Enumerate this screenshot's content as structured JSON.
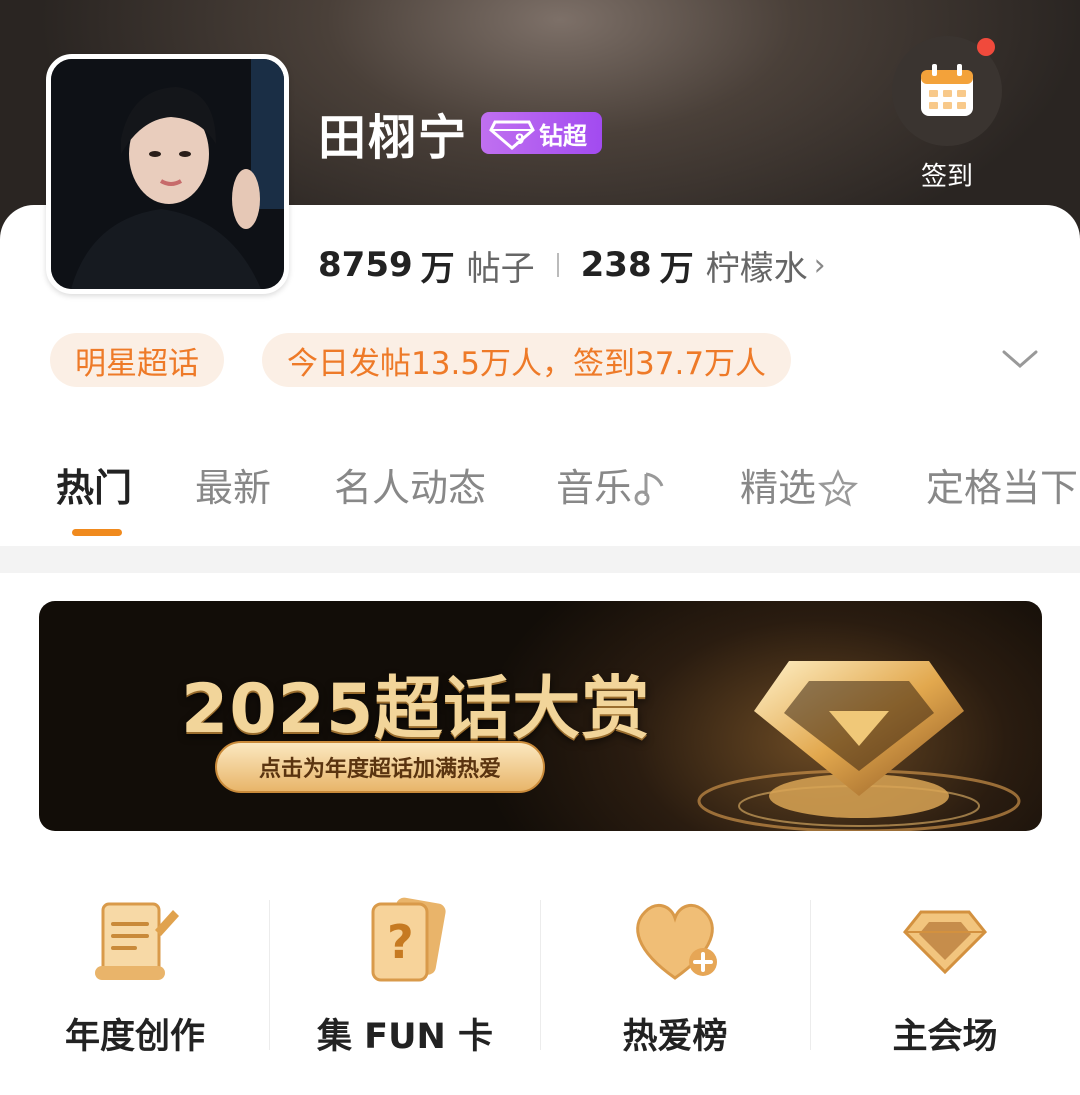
{
  "header": {
    "name": "田栩宁",
    "badge": "钻超",
    "checkin_label": "签到",
    "stats": {
      "posts_num": "8759",
      "posts_unit": "万",
      "posts_label": "帖子",
      "fans_num": "238",
      "fans_unit": "万",
      "fans_label": "柠檬水",
      "arrow": "›"
    }
  },
  "tags": {
    "category": "明星超话",
    "activity": "今日发帖13.5万人，签到37.7万人"
  },
  "tabs": [
    {
      "label": "热门",
      "active": true
    },
    {
      "label": "最新"
    },
    {
      "label": "名人动态"
    },
    {
      "label": "音乐",
      "icon": "music-note-icon"
    },
    {
      "label": "精选",
      "icon": "star-icon"
    },
    {
      "label": "定格当下"
    }
  ],
  "banner": {
    "title": "2025超话大赏",
    "button": "点击为年度超话加满热爱"
  },
  "entries": [
    {
      "label": "年度创作",
      "icon": "scroll-pen-icon"
    },
    {
      "label": "集 FUN 卡",
      "icon": "question-card-icon"
    },
    {
      "label": "热爱榜",
      "icon": "heart-plus-icon"
    },
    {
      "label": "主会场",
      "icon": "diamond-icon"
    }
  ],
  "colors": {
    "accent": "#f08a1e",
    "badge": "#a24bf0",
    "tag_text": "#ee7a28",
    "tag_bg": "#fbefe5"
  }
}
